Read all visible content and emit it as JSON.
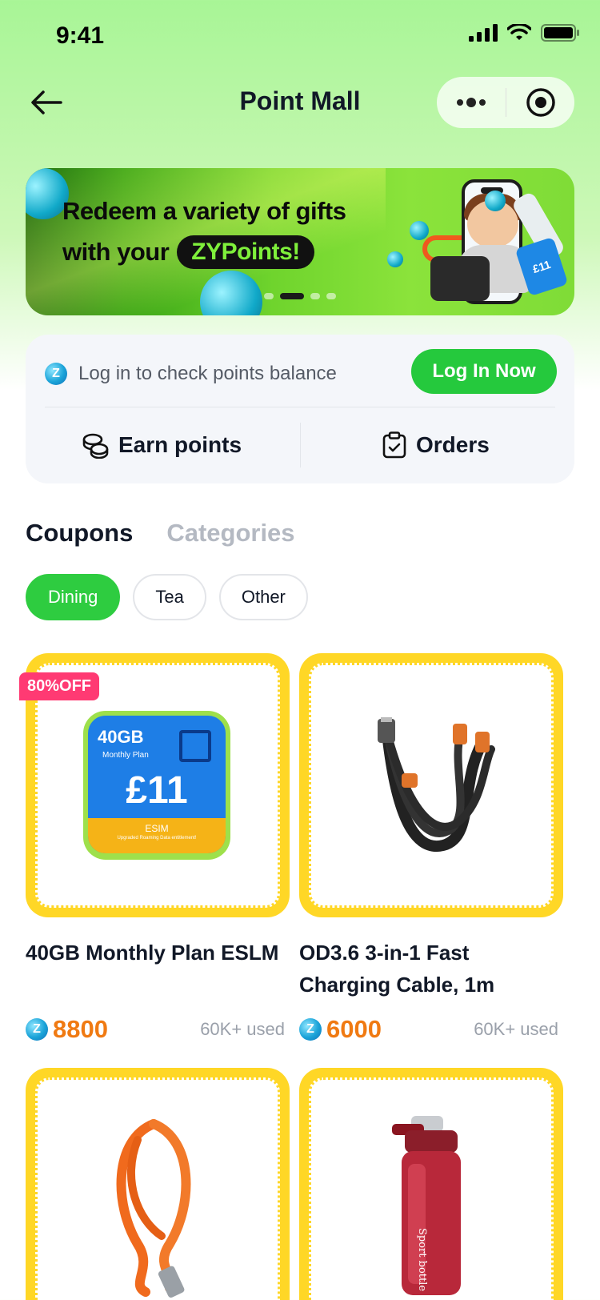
{
  "status_bar": {
    "time": "9:41"
  },
  "nav": {
    "title": "Point Mall"
  },
  "banner": {
    "line1": "Redeem a variety of gifts",
    "line2_prefix": "with your",
    "line2_highlight": "ZYPoints!",
    "card_value": "£11",
    "page_count": 4,
    "active_page": 2
  },
  "points": {
    "login_prompt": "Log in to check points balance",
    "login_button": "Log In Now",
    "earn_label": "Earn points",
    "orders_label": "Orders",
    "coin_letter": "Z"
  },
  "tabs": [
    {
      "label": "Coupons",
      "active": true
    },
    {
      "label": "Categories",
      "active": false
    }
  ],
  "chips": [
    {
      "label": "Dining",
      "active": true
    },
    {
      "label": "Tea",
      "active": false
    },
    {
      "label": "Other",
      "active": false
    }
  ],
  "products": [
    {
      "name": "40GB Monthly Plan ESLM",
      "price": "8800",
      "used": "60K+ used",
      "badge": "80%OFF",
      "plan": {
        "data": "40GB",
        "subtitle": "Monthly Plan",
        "price": "£11",
        "band": "ESIM",
        "band_note": "Upgraded Roaming Data entitlement!"
      }
    },
    {
      "name": "OD3.6 3-in-1 Fast Charging Cable, 1m",
      "price": "6000",
      "used": "60K+ used",
      "badge": ""
    },
    {
      "name": "",
      "price": "",
      "used": "",
      "badge": ""
    },
    {
      "name": "",
      "price": "",
      "used": "",
      "badge": "",
      "bottle_text": "Sport bottle"
    }
  ],
  "colors": {
    "accent_green": "#25c93d",
    "price_orange": "#f07a12",
    "stamp_yellow": "#ffd726",
    "badge_pink": "#ff3a73"
  }
}
